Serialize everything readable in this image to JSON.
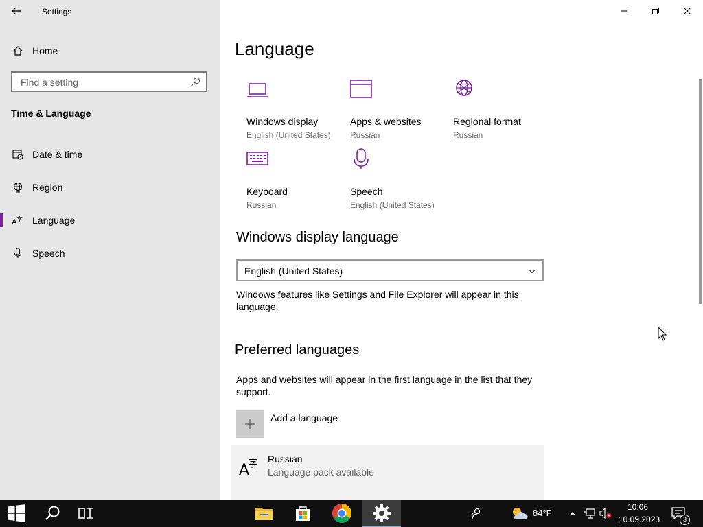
{
  "app": {
    "title": "Settings"
  },
  "sidebar": {
    "home_label": "Home",
    "search_placeholder": "Find a setting",
    "section_title": "Time & Language",
    "items": [
      {
        "label": "Date & time",
        "icon": "calendar-clock-icon"
      },
      {
        "label": "Region",
        "icon": "globe-icon"
      },
      {
        "label": "Language",
        "icon": "language-icon",
        "active": true
      },
      {
        "label": "Speech",
        "icon": "microphone-icon"
      }
    ]
  },
  "main": {
    "title": "Language",
    "tiles": [
      {
        "title": "Windows display",
        "subtitle": "English (United States)",
        "icon": "laptop-icon"
      },
      {
        "title": "Apps & websites",
        "subtitle": "Russian",
        "icon": "browser-window-icon"
      },
      {
        "title": "Regional format",
        "subtitle": "Russian",
        "icon": "regional-globe-icon"
      },
      {
        "title": "Keyboard",
        "subtitle": "Russian",
        "icon": "keyboard-icon"
      },
      {
        "title": "Speech",
        "subtitle": "English (United States)",
        "icon": "microphone-icon"
      }
    ],
    "display_language": {
      "heading": "Windows display language",
      "selected": "English (United States)",
      "description": "Windows features like Settings and File Explorer will appear in this language."
    },
    "preferred": {
      "heading": "Preferred languages",
      "description": "Apps and websites will appear in the first language in the list that they support.",
      "add_label": "Add a language",
      "languages": [
        {
          "name": "Russian",
          "status": "Language pack available"
        }
      ]
    }
  },
  "taskbar": {
    "weather": "84°F",
    "time": "10:06",
    "date": "10.09.2023",
    "notification_count": "3"
  },
  "colors": {
    "accent": "#7b1fa2",
    "sidebar_bg": "#e6e6e6",
    "taskbar_bg": "#101010"
  }
}
